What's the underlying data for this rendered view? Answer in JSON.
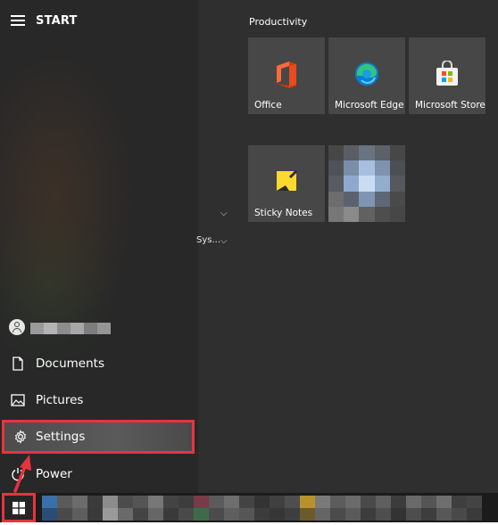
{
  "left_pane": {
    "title": "START",
    "nav": [
      {
        "label": "Documents",
        "icon": "document-icon"
      },
      {
        "label": "Pictures",
        "icon": "pictures-icon"
      },
      {
        "label": "Settings",
        "icon": "gear-icon"
      },
      {
        "label": "Power",
        "icon": "power-icon"
      }
    ]
  },
  "tiles": {
    "group_title": "Productivity",
    "items": [
      {
        "label": "Office",
        "icon": "office-icon"
      },
      {
        "label": "Microsoft Edge",
        "icon": "edge-icon"
      },
      {
        "label": "Microsoft Store",
        "icon": "store-icon"
      },
      {
        "label": "Sticky Notes",
        "icon": "sticky-notes-icon"
      },
      {
        "label": "",
        "icon": "photo-tile-icon"
      }
    ]
  },
  "sys_label": "Sys...",
  "colors": {
    "accent_highlight": "#e8333f",
    "tile_bg": "#474747",
    "pane_bg": "#282828"
  }
}
